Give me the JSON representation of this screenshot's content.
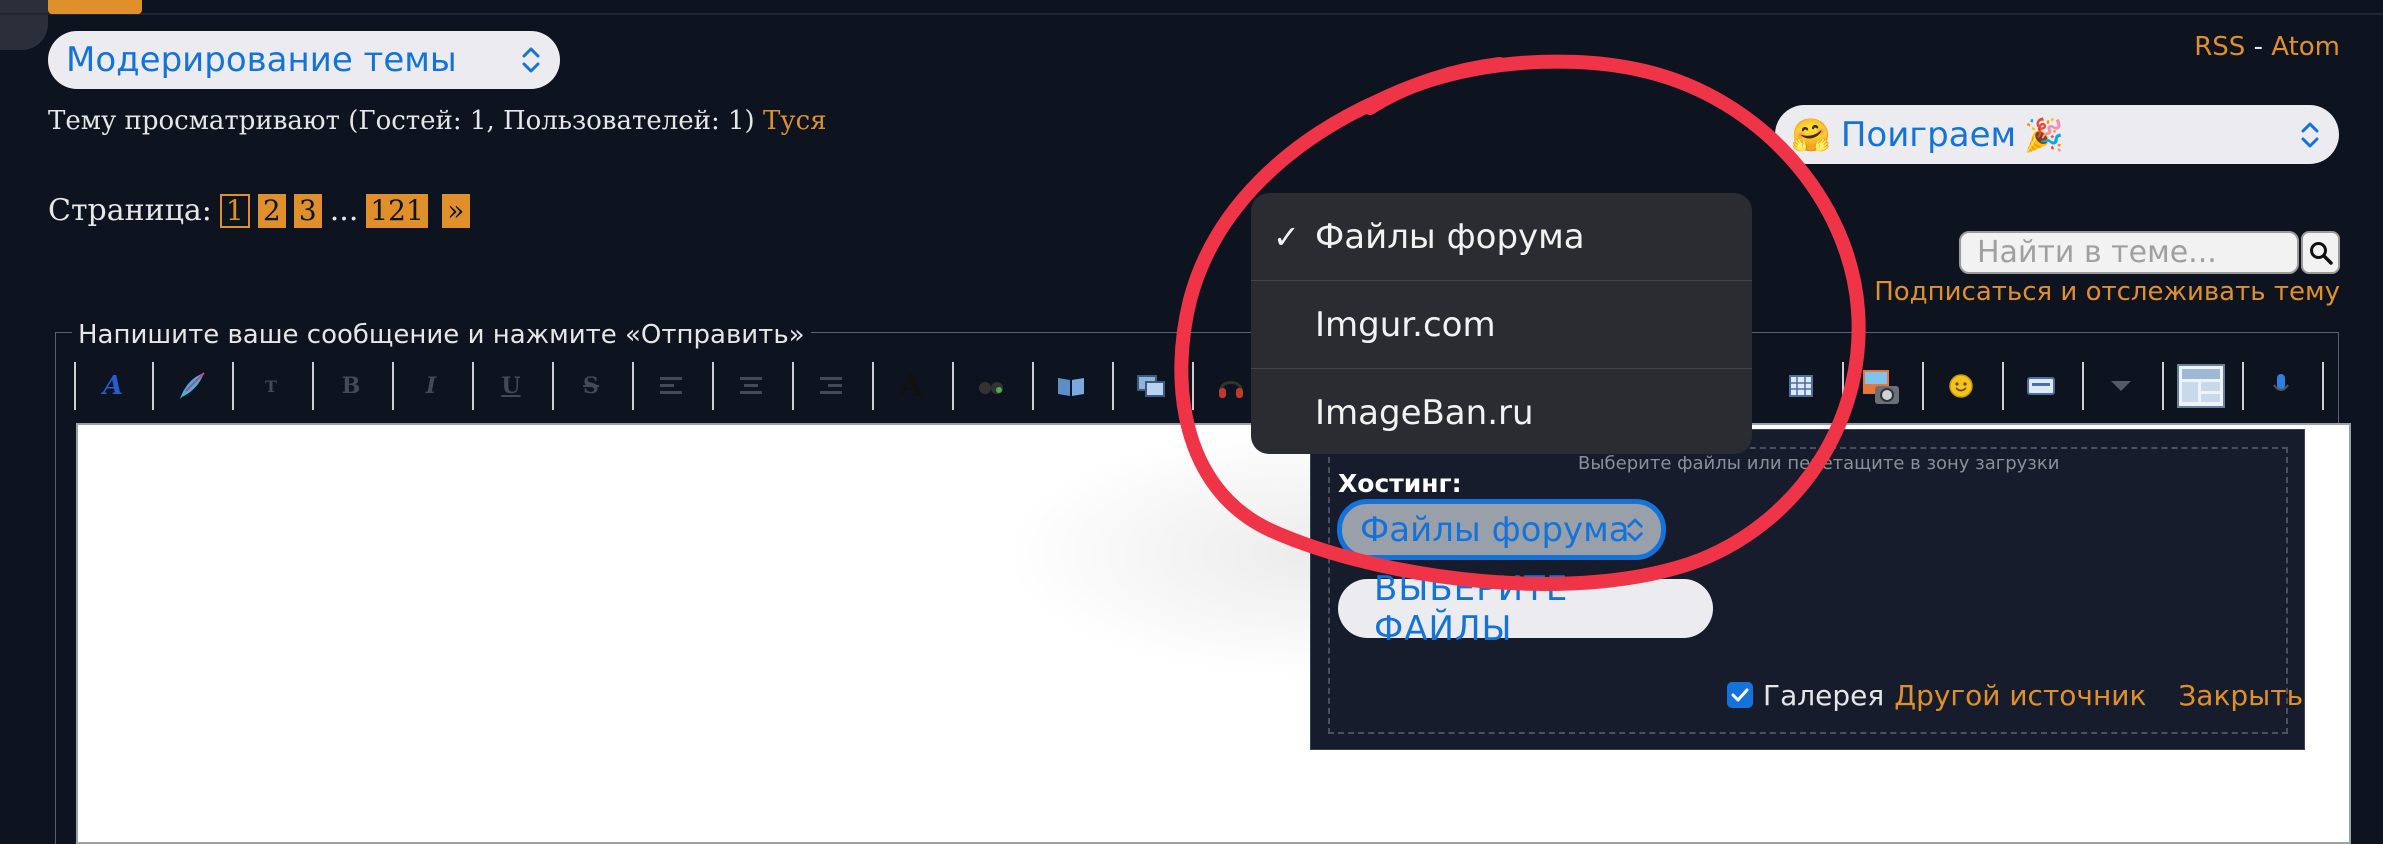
{
  "header": {
    "rss_label": "RSS",
    "rss_separator": " - ",
    "atom_label": "Atom"
  },
  "moderation": {
    "select_value": "Модерирование темы"
  },
  "viewers": {
    "text": "Тему просматривают (Гостей: 1, Пользователей: 1)",
    "user": "Туся"
  },
  "game_select": {
    "emoji_left": "🤗",
    "value": "Поиграем",
    "emoji_right": "🎉"
  },
  "pagination": {
    "label": "Страница:",
    "pages": [
      "1",
      "2",
      "3"
    ],
    "ellipsis": "...",
    "last_page": "121",
    "next": "»"
  },
  "search": {
    "placeholder": "Найти в теме..."
  },
  "subscribe_label": "Подписаться и отслеживать тему",
  "editor": {
    "legend": "Напишите ваше сообщение и нажмите «Отправить»",
    "toolbar_glyphs": {
      "bold": "B",
      "italic": "I",
      "underline": "U",
      "strike": "S",
      "font": "A",
      "size": "T"
    }
  },
  "upload": {
    "dropzone_hint": "Выберите файлы или перетащите в зону загрузки",
    "hosting_label": "Хостинг:",
    "hosting_value": "Файлы форума",
    "choose_button": "ВЫБЕРИТЕ ФАЙЛЫ",
    "gallery_label": "Галерея",
    "other_source": "Другой источник",
    "close": "Закрыть"
  },
  "hosting_dropdown": {
    "check_mark": "✓",
    "options": [
      "Файлы форума",
      "Imgur.com",
      "ImageBan.ru"
    ],
    "selected": "Файлы форума"
  },
  "colors": {
    "background": "#0e1320",
    "accent_orange": "#e0902a",
    "link_blue": "#1473d8",
    "annotation_red": "#f03448"
  }
}
